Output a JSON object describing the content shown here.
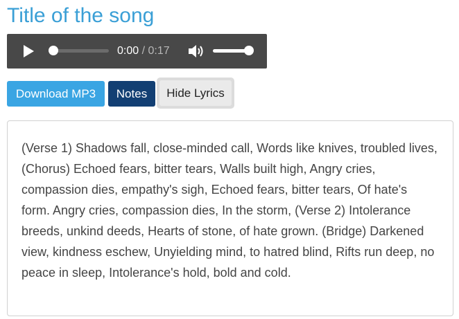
{
  "song": {
    "title": "Title of the song"
  },
  "player": {
    "current_time": "0:00",
    "separator": "/",
    "duration": "0:17",
    "progress": 0,
    "volume": 1,
    "icons": {
      "play": "play-icon",
      "volume": "volume-icon"
    }
  },
  "buttons": {
    "download": "Download MP3",
    "notes": "Notes",
    "hide_lyrics": "Hide Lyrics"
  },
  "lyrics": "(Verse 1) Shadows fall, close-minded call, Words like knives, troubled lives, (Chorus) Echoed fears, bitter tears, Walls built high, Angry cries, compassion dies, empathy's sigh, Echoed fears, bitter tears, Of hate's form. Angry cries, compassion dies, In the storm, (Verse 2) Intolerance breeds, unkind deeds, Hearts of stone, of hate grown. (Bridge) Darkened view, kindness eschew, Unyielding mind, to hatred blind, Rifts run deep, no peace in sleep, Intolerance's hold, bold and cold.",
  "colors": {
    "title": "#3a9fd6",
    "player_bg": "#484848",
    "download_btn": "#3aa5e3",
    "notes_btn": "#123f73"
  }
}
